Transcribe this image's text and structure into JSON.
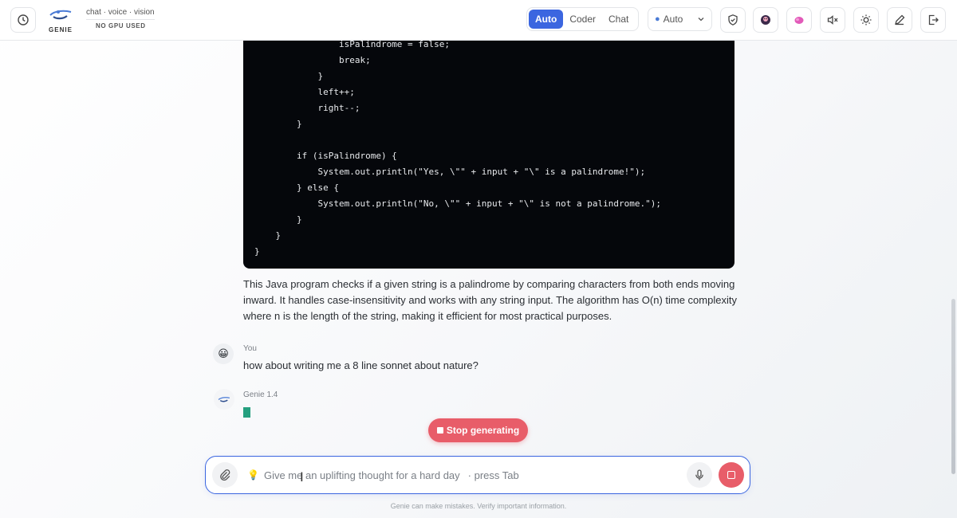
{
  "header": {
    "logo_text": "GENIE",
    "tagline": "chat · voice · vision",
    "gpu_status": "NO GPU USED",
    "modes": [
      "Auto",
      "Coder",
      "Chat"
    ],
    "active_mode": "Auto",
    "language": {
      "selected": "Auto"
    },
    "colors": {
      "accent": "#3b66e0"
    }
  },
  "code": {
    "lines": [
      "                isPalindrome = false;",
      "                break;",
      "            }",
      "            left++;",
      "            right--;",
      "        }",
      "",
      "        if (isPalindrome) {",
      "            System.out.println(\"Yes, \\\"\" + input + \"\\\" is a palindrome!\");",
      "        } else {",
      "            System.out.println(\"No, \\\"\" + input + \"\\\" is not a palindrome.\");",
      "        }",
      "    }",
      "}"
    ]
  },
  "assistant_explanation": "This Java program checks if a given string is a palindrome by comparing characters from both ends moving inward. It handles case-insensitivity and works with any string input. The algorithm has O(n) time complexity where n is the length of the string, making it efficient for most practical purposes.",
  "messages": {
    "user": {
      "sender": "You",
      "text": "how about writing me a 8 line sonnet about nature?"
    },
    "assistant": {
      "sender": "Genie 1.4"
    }
  },
  "stop_button": {
    "label": "Stop generating"
  },
  "composer": {
    "placeholder": "Give me an uplifting thought for a hard day",
    "hint": "· press Tab"
  },
  "disclaimer": "Genie can make mistakes. Verify important information.",
  "colors": {
    "stop": "#e85d69",
    "code_bg": "#05070b",
    "typing_cursor": "#25a07f"
  }
}
